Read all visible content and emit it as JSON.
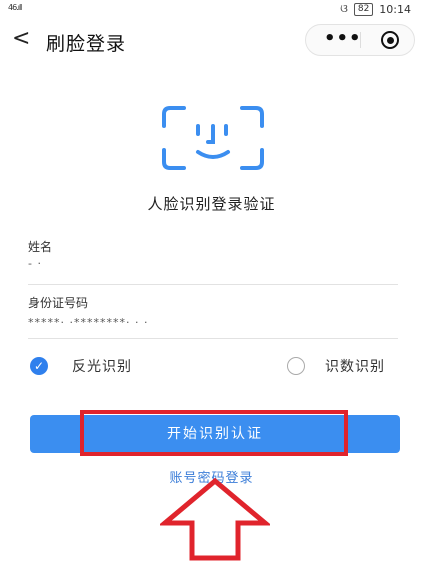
{
  "status_bar": {
    "signal": "46.ıll",
    "battery": "82",
    "time": "10:14",
    "notification_icon": "cat-icon"
  },
  "nav": {
    "back_icon": "<",
    "title": "刷脸登录",
    "more_icon": "•••",
    "target_icon": "record-icon"
  },
  "face_icon": "face-scan-icon",
  "subtitle": "人脸识别登录验证",
  "fields": {
    "name": {
      "label": "姓名",
      "value": "- ·"
    },
    "id": {
      "label": "身份证号码",
      "value": "*****· ·********· · ·"
    }
  },
  "options": [
    {
      "label": "反光识别",
      "checked": true
    },
    {
      "label": "识数识别",
      "checked": false
    }
  ],
  "start_button": {
    "label": "开始识别认证"
  },
  "account_link": "账号密码登录",
  "colors": {
    "primary": "#3b8ef0",
    "annotation": "#e0242c",
    "link": "#3b7dd8"
  }
}
